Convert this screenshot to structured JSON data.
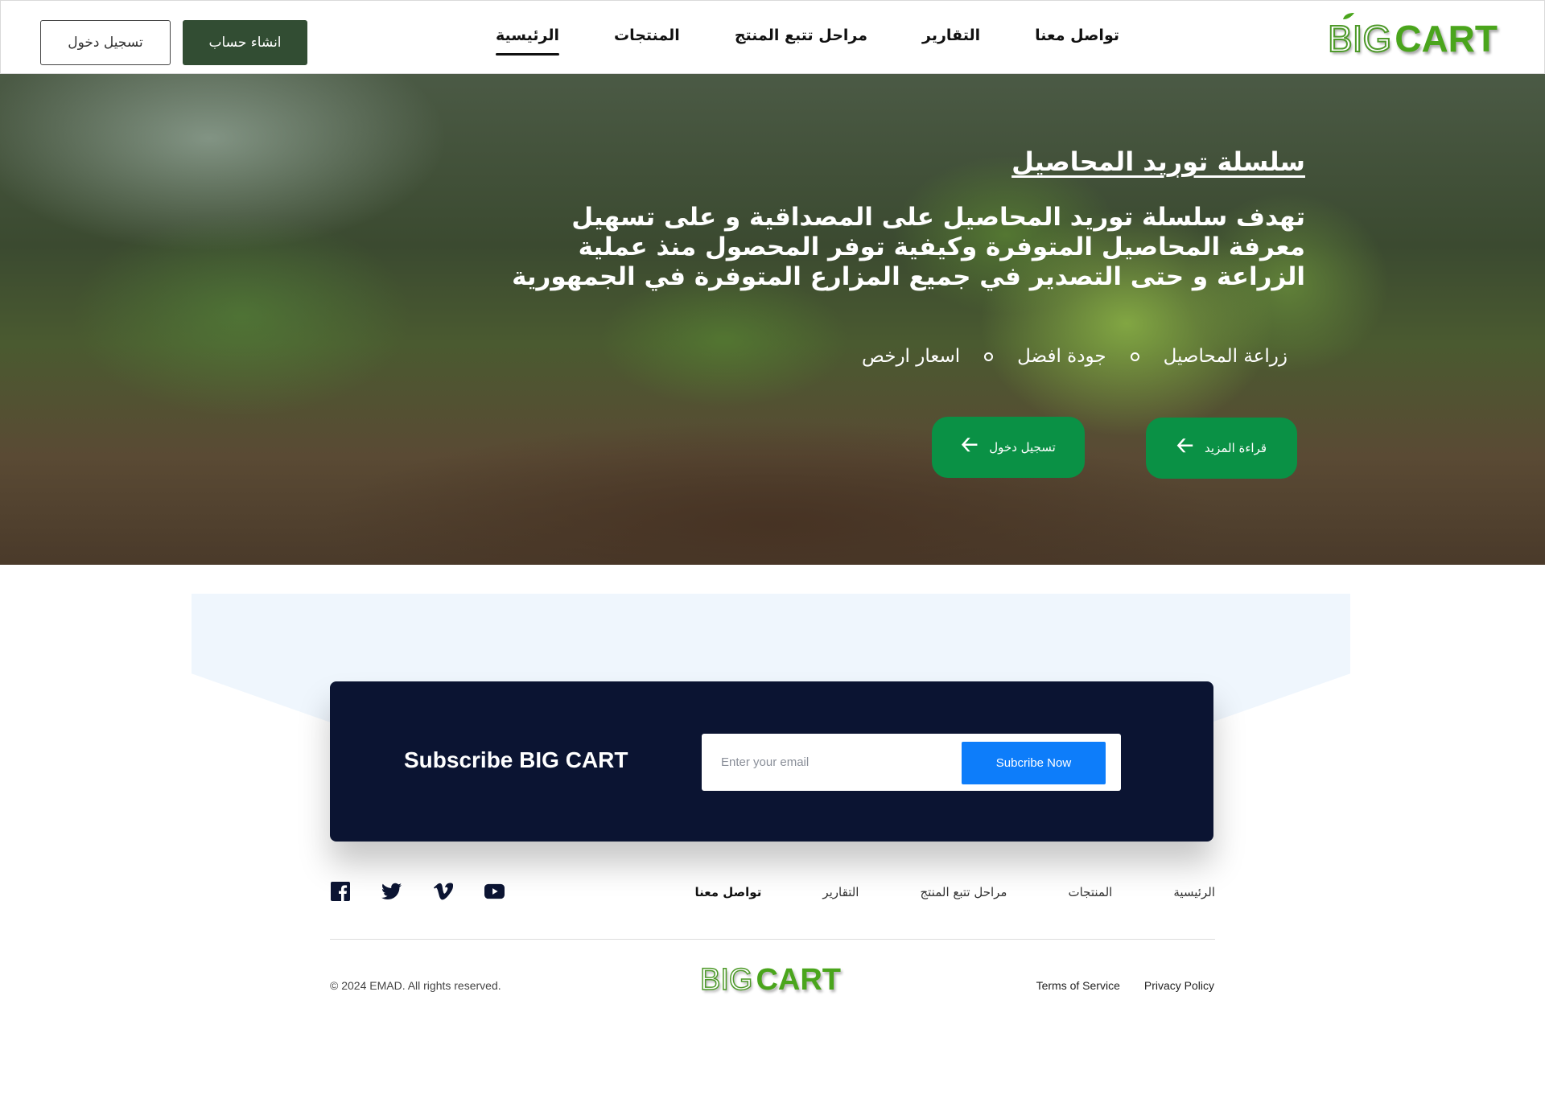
{
  "brand": {
    "logo_big": "BIG",
    "logo_cart": "CART"
  },
  "header": {
    "nav": [
      {
        "label": "الرئيسية",
        "active": true
      },
      {
        "label": "المنتجات"
      },
      {
        "label": "مراحل تتبع المنتج"
      },
      {
        "label": "التقارير"
      },
      {
        "label": "تواصل معنا"
      }
    ],
    "signup_label": "انشاء حساب",
    "login_label": "تسجيل دخول"
  },
  "hero": {
    "title": "سلسلة توريد المحاصيل",
    "description": "تهدف سلسلة توريد المحاصيل على المصداقية و على تسهيل معرفة المحاصيل المتوفرة وكيفية توفر المحصول منذ عملية الزراعة و حتى التصدير في جميع المزارع المتوفرة في الجمهورية",
    "features": [
      "زراعة المحاصيل",
      "جودة افضل",
      "اسعار ارخص"
    ],
    "read_more_label": "قراءة المزيد",
    "login_label": "تسجيل دخول"
  },
  "subscribe": {
    "title": "Subscribe BIG CART",
    "email_placeholder": "Enter your email",
    "button_label": "Subcribe Now"
  },
  "footer": {
    "nav": [
      {
        "label": "الرئيسية"
      },
      {
        "label": "المنتجات"
      },
      {
        "label": "مراحل تتبع المنتج"
      },
      {
        "label": "التقارير"
      },
      {
        "label": "تواصل معنا",
        "strong": true
      }
    ],
    "social": [
      "facebook-icon",
      "twitter-icon",
      "vimeo-icon",
      "youtube-icon"
    ],
    "copyright": "© 2024 EMAD. All rights reserved.",
    "links": {
      "privacy": "Privacy Policy",
      "terms": "Terms of Service"
    }
  },
  "colors": {
    "header_button": "#324d33",
    "hero_button": "#0a9145",
    "subscribe_card": "#0b1432",
    "subscribe_button": "#0d7dfa",
    "logo_green": "#4aa51c"
  }
}
